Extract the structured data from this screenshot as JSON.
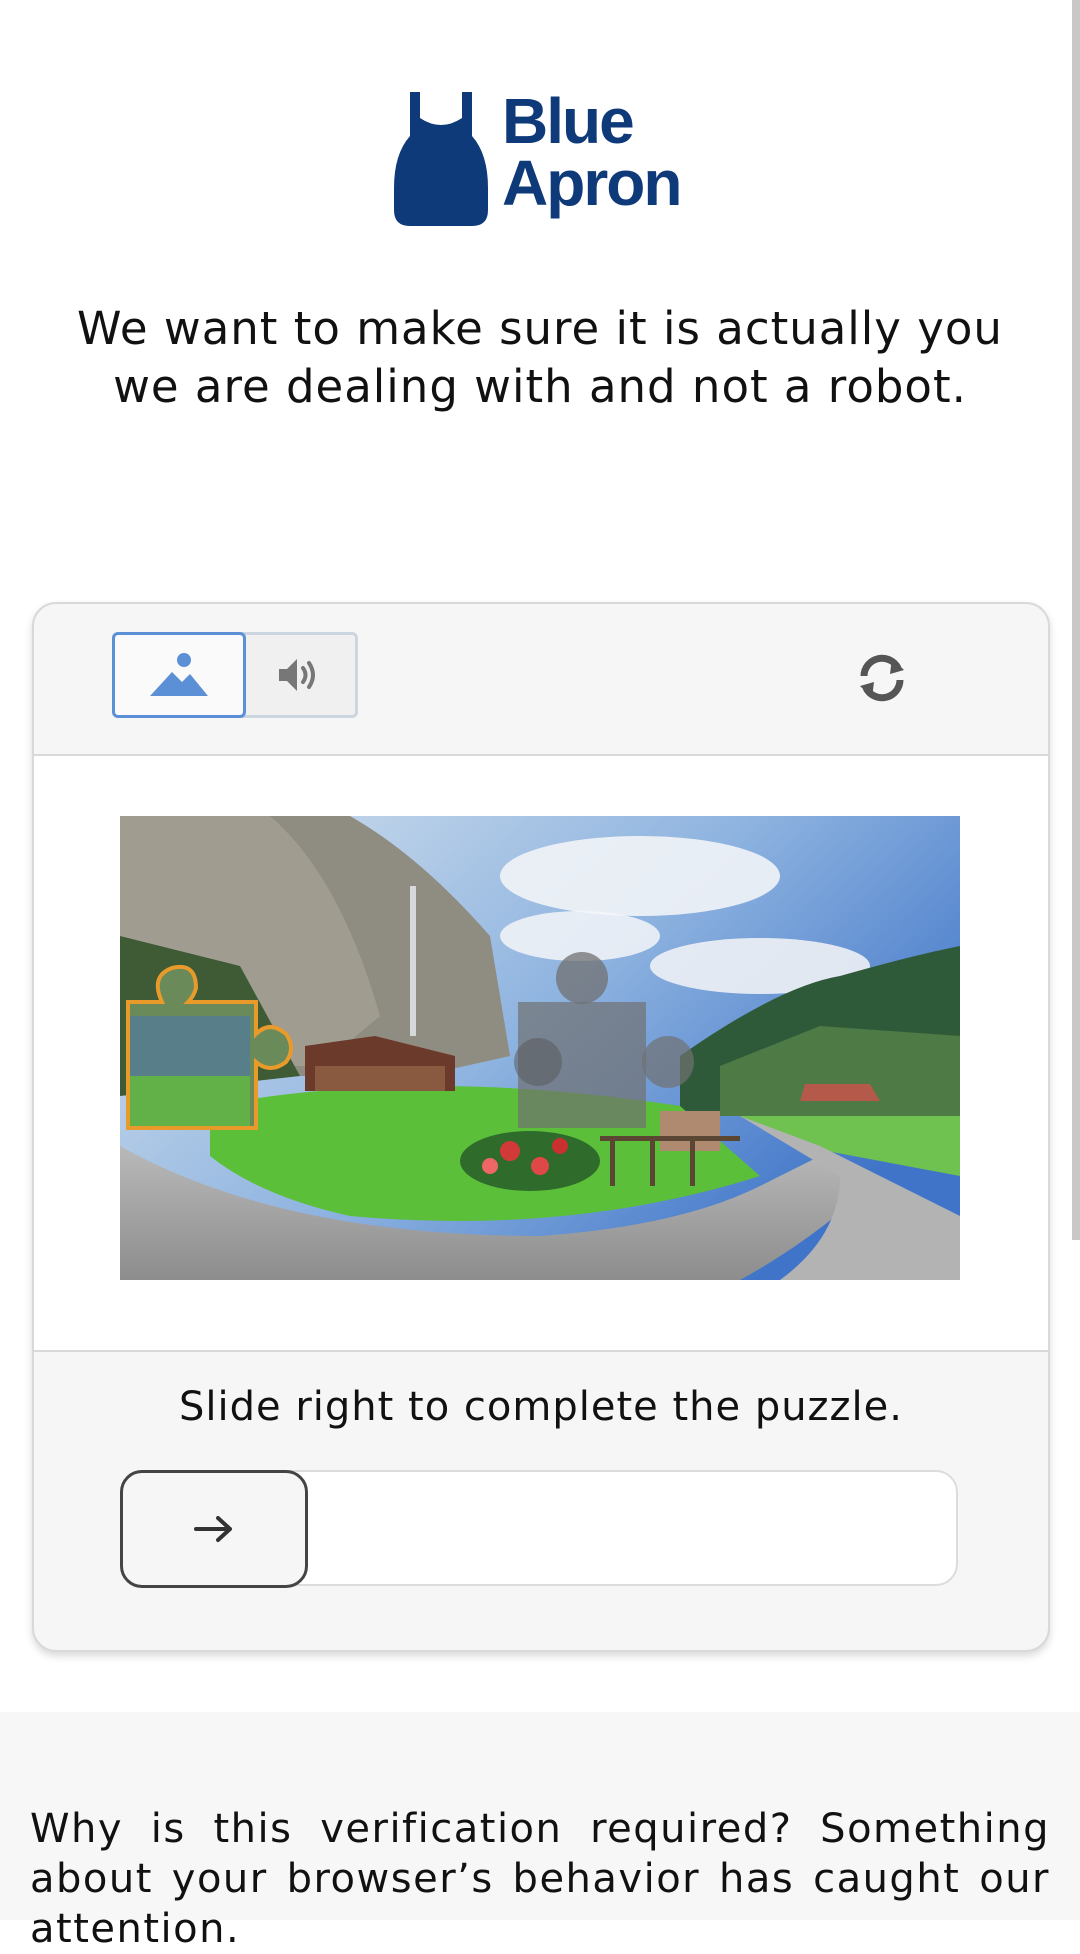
{
  "brand": {
    "name_line1": "Blue",
    "name_line2": "Apron",
    "color": "#0f3a7a",
    "logo_icon": "apron-icon"
  },
  "headline": {
    "line1": "We want to make sure it is actually you",
    "line2": "we are dealing with and not a robot."
  },
  "captcha": {
    "modes": [
      {
        "name": "image",
        "icon": "image-icon",
        "selected": true
      },
      {
        "name": "audio",
        "icon": "speaker-icon",
        "selected": false
      }
    ],
    "refresh_icon": "refresh-icon",
    "puzzle_image": "mountain-valley-landscape",
    "instruction": "Slide right to complete the puzzle.",
    "slider": {
      "handle_icon": "arrow-right-icon",
      "progress": 0
    },
    "accent": "#5b8fd6"
  },
  "footer": {
    "text": "Why is this verification required? Something about your browser’s behavior has caught our attention."
  }
}
